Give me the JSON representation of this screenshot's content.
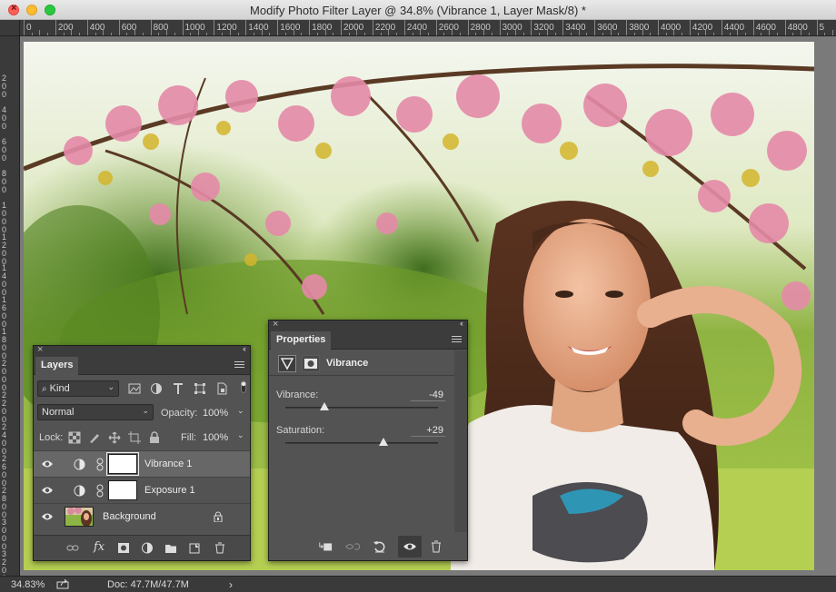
{
  "window": {
    "title": "Modify Photo Filter Layer @ 34.8% (Vibrance 1, Layer Mask/8) *"
  },
  "ruler": {
    "top_labels": [
      "0",
      "200",
      "400",
      "600",
      "800",
      "1000",
      "1200",
      "1400",
      "1600",
      "1800",
      "2000",
      "2200",
      "2400",
      "2600",
      "2800",
      "3000",
      "3200",
      "3400",
      "3600",
      "3800",
      "4000",
      "4200",
      "4400",
      "4600",
      "4800",
      "5"
    ],
    "left_labels": [
      "200",
      "400",
      "600",
      "800",
      "1000",
      "1200",
      "1400",
      "1600",
      "1800",
      "2000",
      "2200",
      "2400",
      "2600",
      "2800",
      "3000",
      "3200"
    ]
  },
  "status": {
    "zoom": "34.83%",
    "doc": "Doc: 47.7M/47.7M",
    "arrow": "›"
  },
  "layers_panel": {
    "tab": "Layers",
    "filter_kind": "Kind",
    "blend_mode": "Normal",
    "opacity_label": "Opacity:",
    "opacity_value": "100%",
    "lock_label": "Lock:",
    "fill_label": "Fill:",
    "fill_value": "100%",
    "layers": [
      {
        "name": "Vibrance 1",
        "selected": true,
        "type": "adjustment"
      },
      {
        "name": "Exposure 1",
        "selected": false,
        "type": "adjustment"
      },
      {
        "name": "Background",
        "selected": false,
        "type": "image",
        "locked": true
      }
    ],
    "footer_icons": [
      "link-icon",
      "fx-icon",
      "add-mask-icon",
      "new-adjustment-icon",
      "new-group-icon",
      "new-layer-icon",
      "trash-icon"
    ]
  },
  "properties_panel": {
    "tab": "Properties",
    "title": "Vibrance",
    "sliders": [
      {
        "label": "Vibrance:",
        "value": "-49",
        "numeric": -49
      },
      {
        "label": "Saturation:",
        "value": "+29",
        "numeric": 29
      }
    ],
    "footer_icons": [
      "clip-to-layer-icon",
      "view-previous-icon",
      "reset-icon",
      "visibility-icon",
      "trash-icon"
    ]
  },
  "colors": {
    "panel_bg": "#535353",
    "selected_row": "#676767",
    "ruler_bg": "#3a3a3a"
  }
}
